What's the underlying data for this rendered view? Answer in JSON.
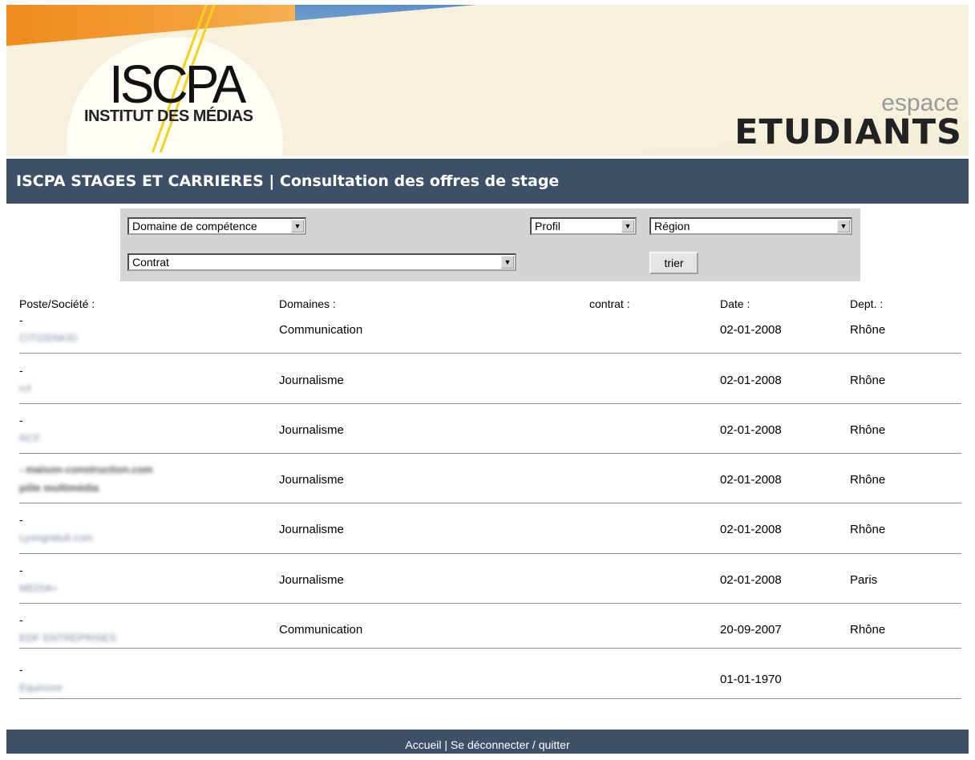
{
  "banner": {
    "logo_text": "ISCPA",
    "logo_subtitle": "INSTITUT DES MÉDIAS",
    "espace": "espace",
    "etudiants": "ETUDIANTS"
  },
  "titlebar": {
    "title": "ISCPA STAGES ET CARRIERES | Consultation des offres de stage"
  },
  "filters": {
    "domaine": "Domaine de compétence",
    "profil": "Profil",
    "region": "Région",
    "contrat": "Contrat",
    "trier": "trier"
  },
  "table": {
    "headers": {
      "poste": "Poste/Société :",
      "domaines": "Domaines :",
      "contrat": "contrat :",
      "date": "Date :",
      "dept": "Dept. :"
    },
    "rows": [
      {
        "dash": "-",
        "company": "CITIZENKID",
        "company2": "",
        "domaine": "Communication",
        "contrat": "",
        "date": "02-01-2008",
        "dept": "Rhône"
      },
      {
        "dash": "-",
        "company": "rcf",
        "company2": "",
        "domaine": "Journalisme",
        "contrat": "",
        "date": "02-01-2008",
        "dept": "Rhône"
      },
      {
        "dash": "-",
        "company": "RCF",
        "company2": "",
        "domaine": "Journalisme",
        "contrat": "",
        "date": "02-01-2008",
        "dept": "Rhône"
      },
      {
        "dash": "- maison-construction.com",
        "company": "pôle multimédia",
        "company2": "",
        "domaine": "Journalisme",
        "contrat": "",
        "date": "02-01-2008",
        "dept": "Rhône"
      },
      {
        "dash": "-",
        "company": "Lyongratuit.com",
        "company2": "",
        "domaine": "Journalisme",
        "contrat": "",
        "date": "02-01-2008",
        "dept": "Rhône"
      },
      {
        "dash": "-",
        "company": "MEDIA+",
        "company2": "",
        "domaine": "Journalisme",
        "contrat": "",
        "date": "02-01-2008",
        "dept": "Paris"
      },
      {
        "dash": "-",
        "company": "EDF ENTREPRISES",
        "company2": "",
        "domaine": "Communication",
        "contrat": "",
        "date": "20-09-2007",
        "dept": "Rhône"
      },
      {
        "dash": "-",
        "company": "Equinoxe",
        "company2": "",
        "domaine": "",
        "contrat": "",
        "date": "01-01-1970",
        "dept": ""
      }
    ]
  },
  "footer": {
    "accueil": "Accueil",
    "separator": " | ",
    "logout": "Se déconnecter / quitter"
  },
  "colors": {
    "header_bar": "#3d5068",
    "banner_orange": "#f08a1c",
    "filter_bg": "#d4d4d4"
  }
}
